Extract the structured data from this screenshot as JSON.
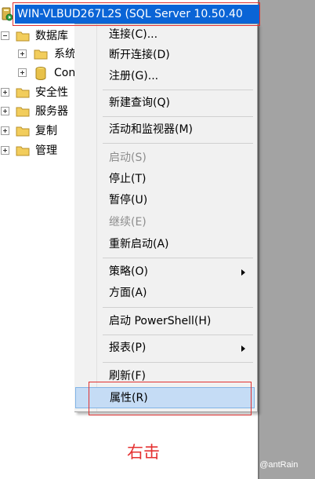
{
  "server": {
    "label": "WIN-VLBUD267L2S (SQL Server 10.50.40"
  },
  "tree": {
    "databases": "数据库",
    "system_db": "系统",
    "con_db": "Con",
    "security": "安全性",
    "server_objects": "服务器",
    "replication": "复制",
    "management": "管理"
  },
  "menu": {
    "items": [
      {
        "label": "连接(C)...",
        "enabled": true
      },
      {
        "label": "断开连接(D)",
        "enabled": true
      },
      {
        "label": "注册(G)...",
        "enabled": true
      },
      {
        "label": "新建查询(Q)",
        "enabled": true
      },
      {
        "label": "活动和监视器(M)",
        "enabled": true
      },
      {
        "label": "启动(S)",
        "enabled": false
      },
      {
        "label": "停止(T)",
        "enabled": true
      },
      {
        "label": "暂停(U)",
        "enabled": true
      },
      {
        "label": "继续(E)",
        "enabled": false
      },
      {
        "label": "重新启动(A)",
        "enabled": true
      },
      {
        "label": "策略(O)",
        "enabled": true,
        "submenu": true
      },
      {
        "label": "方面(A)",
        "enabled": true
      },
      {
        "label": "启动 PowerShell(H)",
        "enabled": true
      },
      {
        "label": "报表(P)",
        "enabled": true,
        "submenu": true
      },
      {
        "label": "刷新(F)",
        "enabled": true
      },
      {
        "label": "属性(R)",
        "enabled": true,
        "selected": true
      }
    ]
  },
  "annotation": "右击",
  "watermark": "CSDN @antRain",
  "colors": {
    "selection": "#0a64d6",
    "highlight_box": "#e03030",
    "annotation": "#e53232"
  }
}
